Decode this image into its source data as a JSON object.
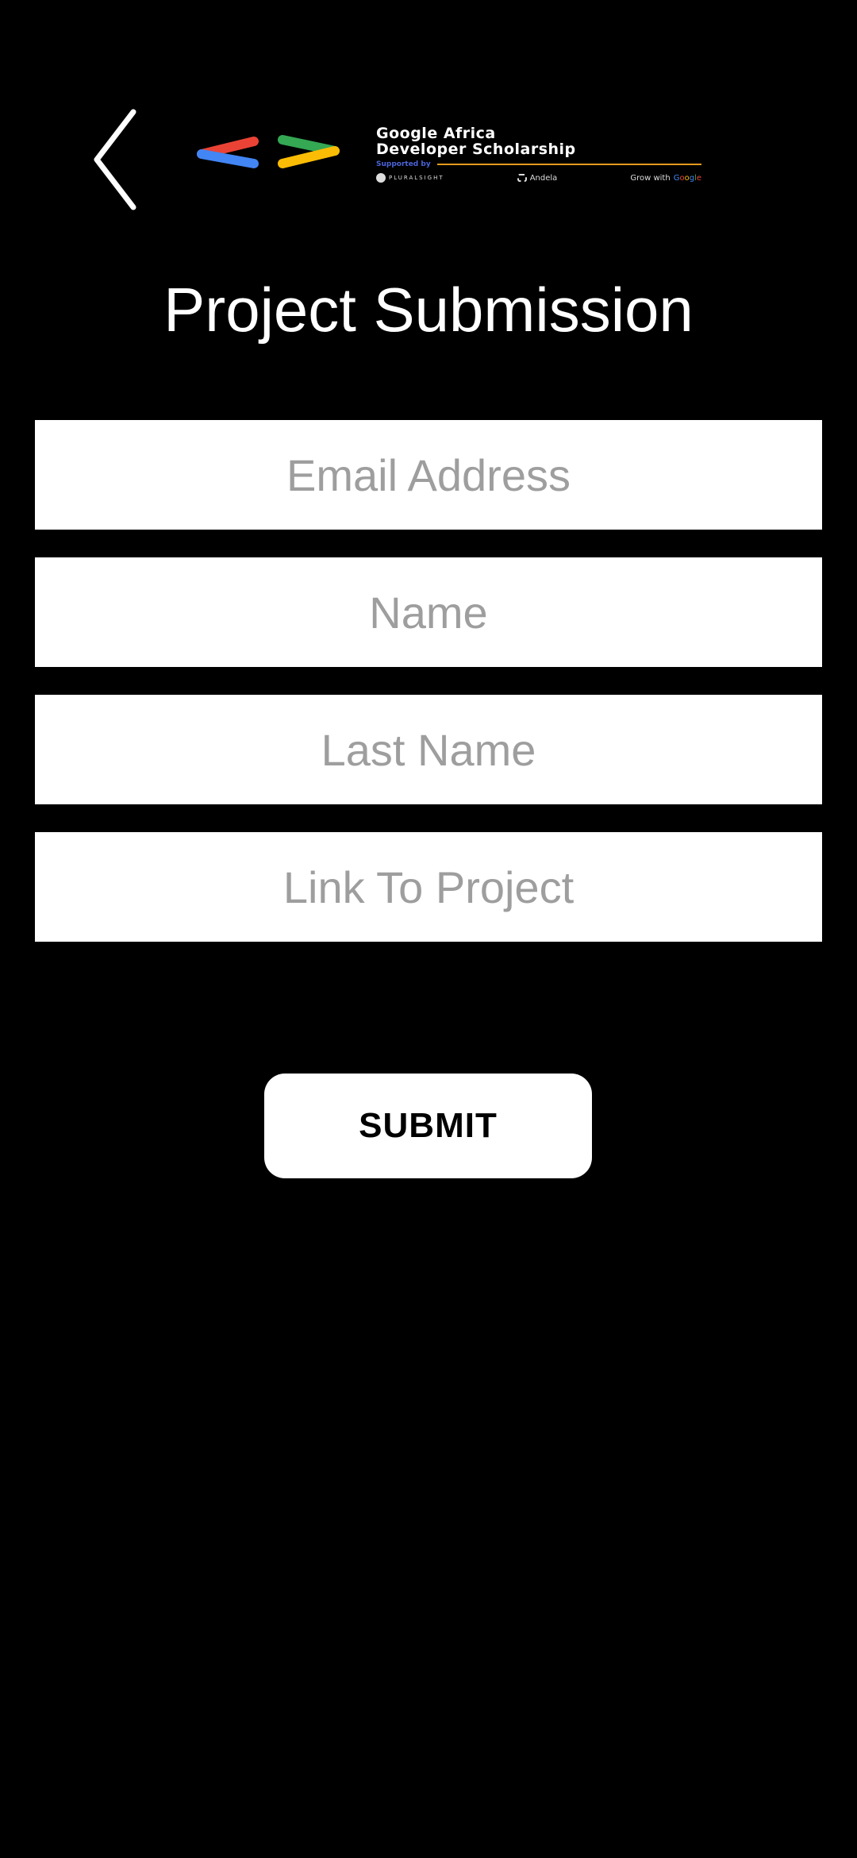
{
  "header": {
    "back_icon": "chevron-left-icon",
    "logo": {
      "title_line1": "Google Africa",
      "title_line2": "Developer Scholarship",
      "supported_by": "Supported by",
      "partners": [
        "PLURALSIGHT",
        "Andela",
        "Grow with Google"
      ],
      "partner_prefix_grow": "Grow with",
      "mark_colors": [
        "#4285f4",
        "#ea4335",
        "#34a853",
        "#fbbc05"
      ]
    }
  },
  "page": {
    "title": "Project Submission"
  },
  "form": {
    "fields": [
      {
        "placeholder": "Email Address",
        "value": ""
      },
      {
        "placeholder": "Name",
        "value": ""
      },
      {
        "placeholder": "Last Name",
        "value": ""
      },
      {
        "placeholder": "Link To Project",
        "value": ""
      }
    ],
    "submit_label": "SUBMIT"
  },
  "colors": {
    "background": "#000000",
    "field_background": "#ffffff",
    "placeholder": "#9e9e9e",
    "text": "#ffffff"
  }
}
